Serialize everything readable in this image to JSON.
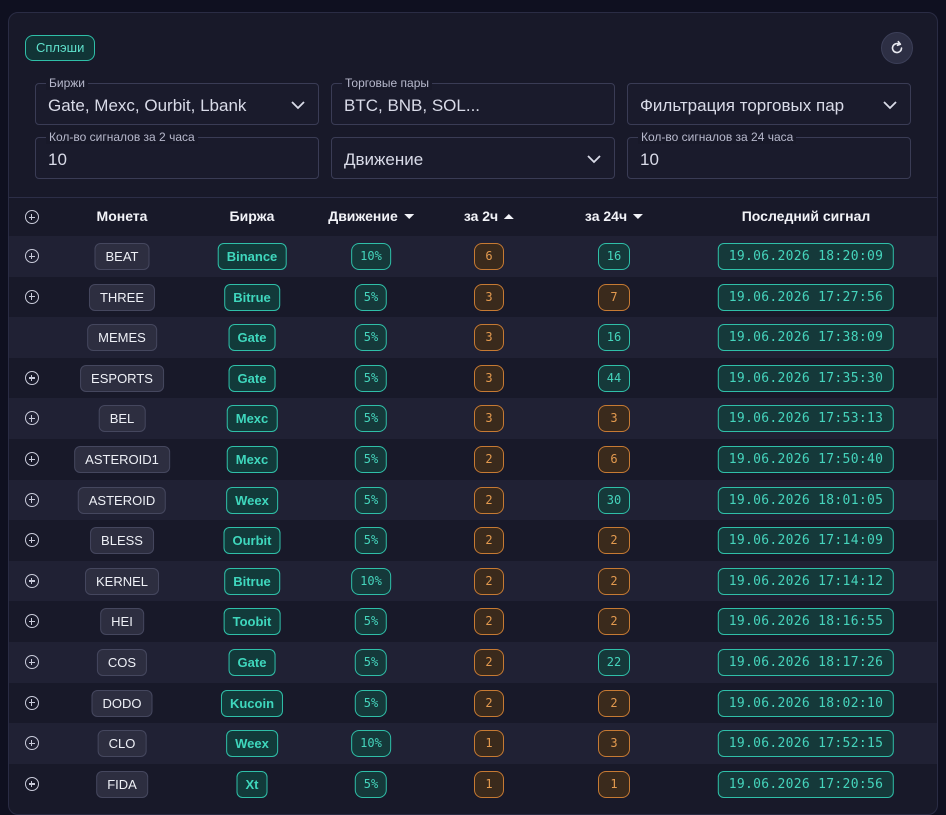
{
  "top_chip": "Сплэши",
  "filters": {
    "exchanges": {
      "legend": "Биржи",
      "value": "Gate, Mexc, Ourbit, Lbank"
    },
    "pairs": {
      "legend": "Торговые пары",
      "value": "BTC, BNB, SOL..."
    },
    "pair_filter": {
      "value": "Фильтрация торговых пар"
    },
    "signals_2h": {
      "legend": "Кол-во сигналов за 2 часа",
      "value": "10"
    },
    "movement": {
      "value": "Движение"
    },
    "signals_24h": {
      "legend": "Кол-во сигналов за 24 часа",
      "value": "10"
    }
  },
  "table": {
    "headers": {
      "coin": "Монета",
      "exchange": "Биржа",
      "movement": "Движение",
      "c2h": "за 2ч",
      "c24h": "за 24ч",
      "last": "Последний сигнал"
    },
    "rows": [
      {
        "coin": "BEAT",
        "exchange": "Binance",
        "move": "10%",
        "c2h": "6",
        "c24h": "16",
        "c24h_color": "teal",
        "last": "19.06.2026 18:20:09",
        "expand": true
      },
      {
        "coin": "THREE",
        "exchange": "Bitrue",
        "move": "5%",
        "c2h": "3",
        "c24h": "7",
        "c24h_color": "orange",
        "last": "19.06.2026 17:27:56",
        "expand": true
      },
      {
        "coin": "MEMES",
        "exchange": "Gate",
        "move": "5%",
        "c2h": "3",
        "c24h": "16",
        "c24h_color": "teal",
        "last": "19.06.2026 17:38:09",
        "expand": false
      },
      {
        "coin": "ESPORTS",
        "exchange": "Gate",
        "move": "5%",
        "c2h": "3",
        "c24h": "44",
        "c24h_color": "teal",
        "last": "19.06.2026 17:35:30",
        "expand": true
      },
      {
        "coin": "BEL",
        "exchange": "Mexc",
        "move": "5%",
        "c2h": "3",
        "c24h": "3",
        "c24h_color": "orange",
        "last": "19.06.2026 17:53:13",
        "expand": true
      },
      {
        "coin": "ASTEROID1",
        "exchange": "Mexc",
        "move": "5%",
        "c2h": "2",
        "c24h": "6",
        "c24h_color": "orange",
        "last": "19.06.2026 17:50:40",
        "expand": true
      },
      {
        "coin": "ASTEROID",
        "exchange": "Weex",
        "move": "5%",
        "c2h": "2",
        "c24h": "30",
        "c24h_color": "teal",
        "last": "19.06.2026 18:01:05",
        "expand": true
      },
      {
        "coin": "BLESS",
        "exchange": "Ourbit",
        "move": "5%",
        "c2h": "2",
        "c24h": "2",
        "c24h_color": "orange",
        "last": "19.06.2026 17:14:09",
        "expand": true
      },
      {
        "coin": "KERNEL",
        "exchange": "Bitrue",
        "move": "10%",
        "c2h": "2",
        "c24h": "2",
        "c24h_color": "orange",
        "last": "19.06.2026 17:14:12",
        "expand": true
      },
      {
        "coin": "HEI",
        "exchange": "Toobit",
        "move": "5%",
        "c2h": "2",
        "c24h": "2",
        "c24h_color": "orange",
        "last": "19.06.2026 18:16:55",
        "expand": true
      },
      {
        "coin": "COS",
        "exchange": "Gate",
        "move": "5%",
        "c2h": "2",
        "c24h": "22",
        "c24h_color": "teal",
        "last": "19.06.2026 18:17:26",
        "expand": true
      },
      {
        "coin": "DODO",
        "exchange": "Kucoin",
        "move": "5%",
        "c2h": "2",
        "c24h": "2",
        "c24h_color": "orange",
        "last": "19.06.2026 18:02:10",
        "expand": true
      },
      {
        "coin": "CLO",
        "exchange": "Weex",
        "move": "10%",
        "c2h": "1",
        "c24h": "3",
        "c24h_color": "orange",
        "last": "19.06.2026 17:52:15",
        "expand": true
      },
      {
        "coin": "FIDA",
        "exchange": "Xt",
        "move": "5%",
        "c2h": "1",
        "c24h": "1",
        "c24h_color": "orange",
        "last": "19.06.2026 17:20:56",
        "expand": true
      }
    ]
  },
  "colors": {
    "accent": "#2fbfa8",
    "warning": "#c67a33",
    "background": "#181929"
  }
}
